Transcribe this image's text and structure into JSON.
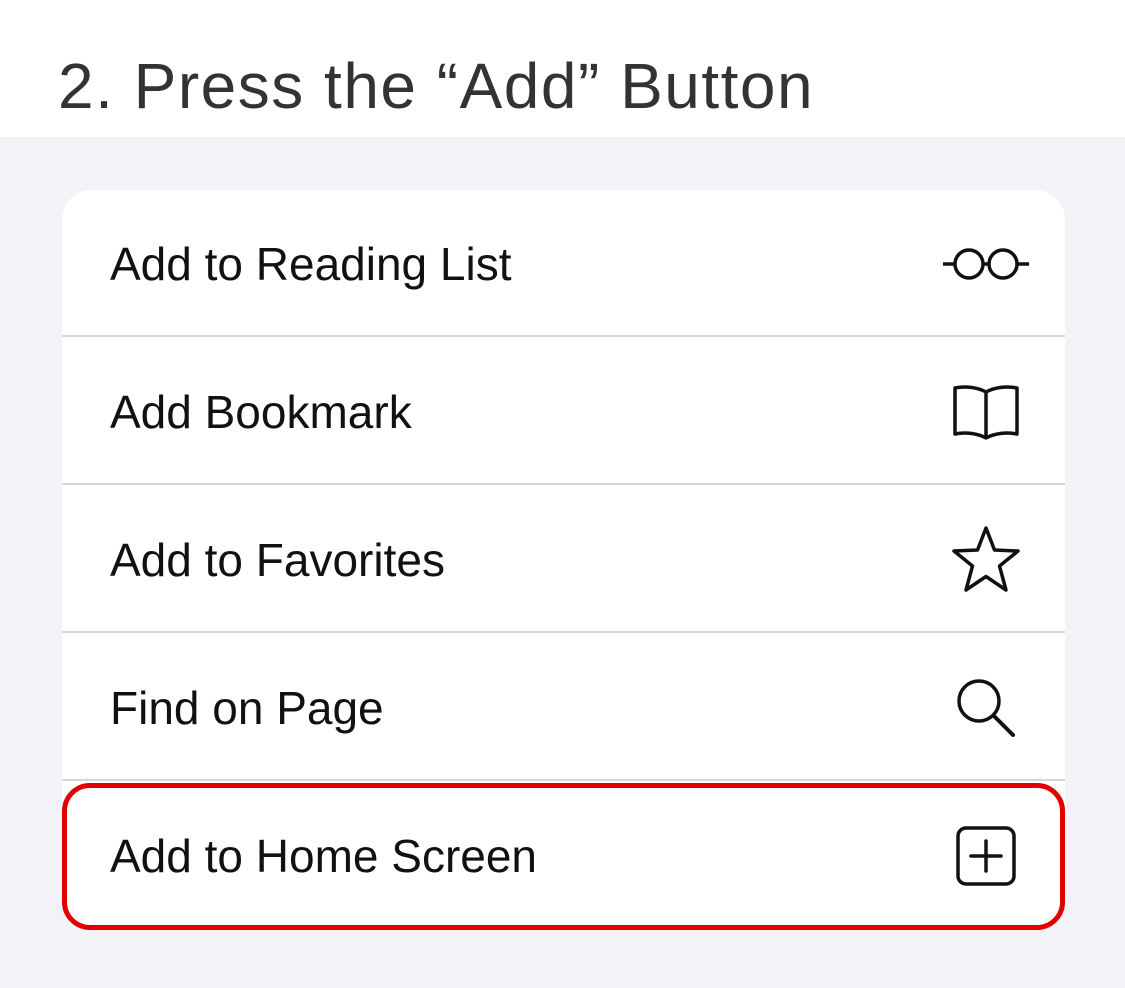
{
  "header": {
    "title": "2. Press the “Add” Button"
  },
  "menu": {
    "items": [
      {
        "label": "Add to Reading List",
        "icon": "glasses-icon"
      },
      {
        "label": "Add Bookmark",
        "icon": "book-icon"
      },
      {
        "label": "Add to Favorites",
        "icon": "star-icon"
      },
      {
        "label": "Find on Page",
        "icon": "search-icon"
      },
      {
        "label": "Add to Home Screen",
        "icon": "add-square-icon"
      }
    ]
  },
  "colors": {
    "highlight": "#e10000",
    "background": "#f2f2f7",
    "text": "#111111"
  }
}
